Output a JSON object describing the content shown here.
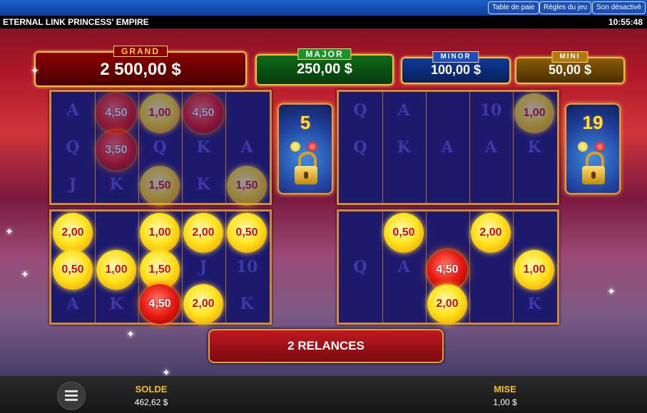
{
  "topbar": {
    "paytable": "Table de paie",
    "rules": "Règles du jeu",
    "sound": "Son désactivé"
  },
  "title": "ETERNAL LINK PRINCESS' EMPIRE",
  "clock": "10:55:48",
  "jackpots": {
    "grand": {
      "label": "GRAND",
      "value": "2 500,00 $"
    },
    "major": {
      "label": "MAJOR",
      "value": "250,00 $"
    },
    "minor": {
      "label": "MINOR",
      "value": "100,00 $"
    },
    "mini": {
      "label": "MINI",
      "value": "50,00 $"
    }
  },
  "locks": {
    "left": "5",
    "right": "19"
  },
  "ghost_symbols": {
    "a": "A",
    "q": "Q",
    "k": "K",
    "j": "J",
    "ten": "10"
  },
  "left_top": {
    "o1": "4,50",
    "o2": "1,00",
    "o3": "4,50",
    "o4": "3,50",
    "o5": "1,50",
    "o6": "1,50"
  },
  "left_bottom": {
    "o1": "2,00",
    "o2": "1,00",
    "o3": "2,00",
    "o4": "0,50",
    "o5": "0,50",
    "o6": "1,00",
    "o7": "1,50",
    "o8": "4,50",
    "o9": "2,00"
  },
  "right_top": {
    "o1": "1,00"
  },
  "right_bottom": {
    "o1": "0,50",
    "o2": "2,00",
    "o3": "4,50",
    "o4": "1,00",
    "o5": "2,00"
  },
  "respins": "2 RELANCES",
  "bottom": {
    "balance_label": "SOLDE",
    "balance": "462,62 $",
    "bet_label": "MISE",
    "bet": "1,00 $"
  },
  "icons": {
    "menu": "hamburger-menu-icon",
    "lock": "padlock-icon",
    "sparkle": "sparkle-icon"
  }
}
